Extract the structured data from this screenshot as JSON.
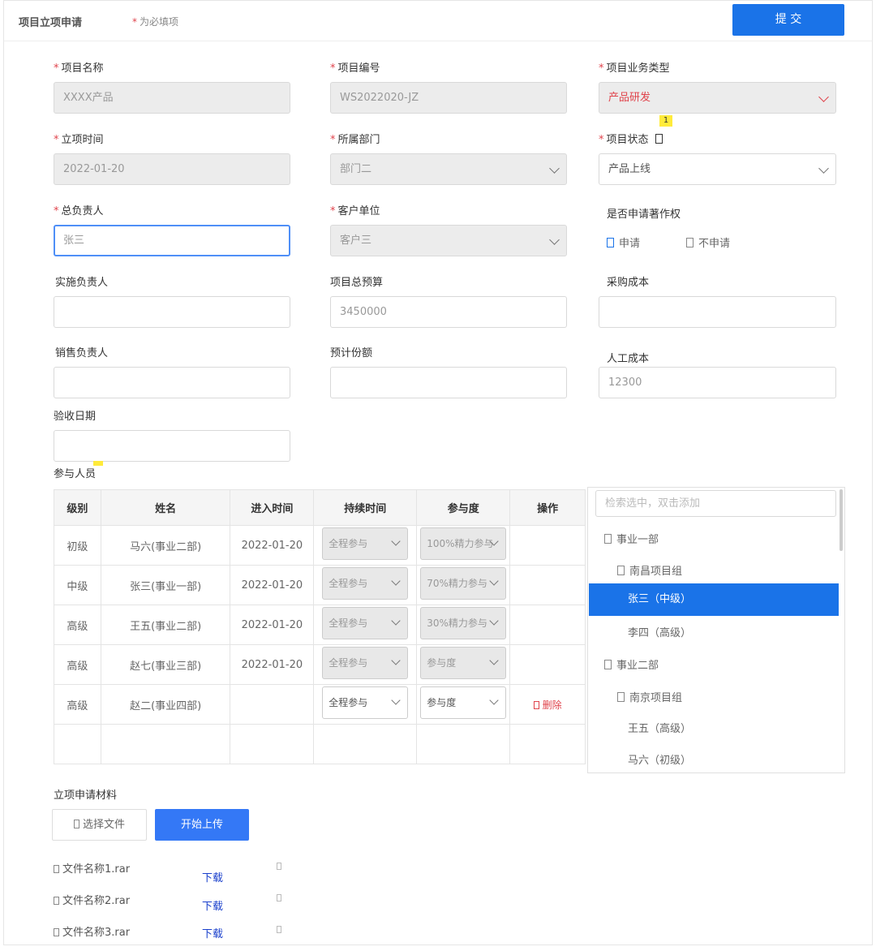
{
  "header": {
    "title": "项目立项申请",
    "required_note": "为必填项",
    "submit_label": "提 交"
  },
  "form": {
    "project_name": {
      "label": "项目名称",
      "value": "XXXX产品"
    },
    "project_no": {
      "label": "项目编号",
      "value": "WS2022020-JZ"
    },
    "biz_type": {
      "label": "项目业务类型",
      "value": "产品研发"
    },
    "setup_time": {
      "label": "立项时间",
      "value": "2022-01-20"
    },
    "department": {
      "label": "所属部门",
      "value": "部门二"
    },
    "status": {
      "label": "项目状态",
      "value": "产品上线",
      "badge": "1"
    },
    "owner": {
      "label": "总负责人",
      "value": "张三"
    },
    "client": {
      "label": "客户单位",
      "value": "客户三"
    },
    "copyright": {
      "label": "是否申请著作权",
      "option_yes": "申请",
      "option_no": "不申请"
    },
    "impl_owner": {
      "label": "实施负责人",
      "value": ""
    },
    "budget": {
      "label": "项目总预算",
      "value": "3450000"
    },
    "purchase_cost": {
      "label": "采购成本",
      "value": ""
    },
    "sales_owner": {
      "label": "销售负责人",
      "value": ""
    },
    "est_share": {
      "label": "预计份额",
      "value": ""
    },
    "labor_cost": {
      "label": "人工成本",
      "value": "12300"
    },
    "accept_date": {
      "label": "验收日期",
      "value": ""
    }
  },
  "participants": {
    "label": "参与人员",
    "columns": [
      "级别",
      "姓名",
      "进入时间",
      "持续时间",
      "参与度",
      "操作"
    ],
    "rows": [
      {
        "level": "初级",
        "name": "马六(事业二部)",
        "date": "2022-01-20",
        "duration": "全程参与",
        "degree": "100%精力参与"
      },
      {
        "level": "中级",
        "name": "张三(事业一部)",
        "date": "2022-01-20",
        "duration": "全程参与",
        "degree": "70%精力参与"
      },
      {
        "level": "高级",
        "name": "王五(事业二部)",
        "date": "2022-01-20",
        "duration": "全程参与",
        "degree": "30%精力参与"
      },
      {
        "level": "高级",
        "name": "赵七(事业三部)",
        "date": "2022-01-20",
        "duration": "全程参与",
        "degree": "参与度"
      },
      {
        "level": "高级",
        "name": "赵二(事业四部)",
        "date": "",
        "duration": "全程参与",
        "degree": "参与度",
        "action": "删除"
      }
    ]
  },
  "tree": {
    "search_placeholder": "检索选中，双击添加",
    "items": [
      "事业一部",
      "南昌项目组",
      "张三（中级）",
      "李四（高级）",
      "事业二部",
      "南京项目组",
      "王五（高级）",
      "马六（初级）"
    ]
  },
  "materials": {
    "label": "立项申请材料",
    "choose_label": "选择文件",
    "upload_label": "开始上传",
    "download_label": "下载",
    "files": [
      "文件名称1.rar",
      "文件名称2.rar",
      "文件名称3.rar"
    ]
  },
  "colors": {
    "primary": "#1a73e8",
    "required": "#e0434b",
    "selected_bg": "#1a73e8"
  }
}
